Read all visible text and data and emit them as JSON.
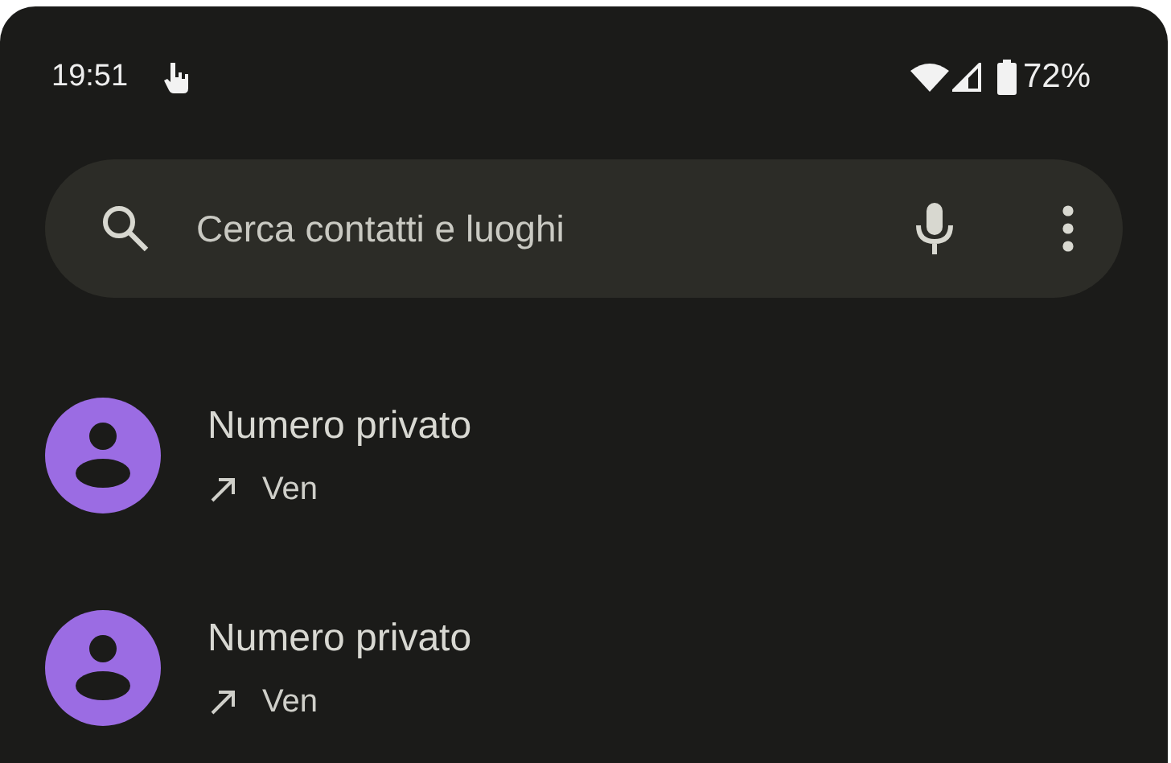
{
  "status_bar": {
    "time": "19:51",
    "battery": "72%"
  },
  "search": {
    "placeholder": "Cerca contatti e luoghi"
  },
  "calls": [
    {
      "name": "Numero privato",
      "kind": "outgoing",
      "day": "Ven",
      "color": "#9b6ce3"
    },
    {
      "name": "Numero privato",
      "kind": "outgoing",
      "day": "Ven",
      "color": "#9b6ce3"
    }
  ]
}
